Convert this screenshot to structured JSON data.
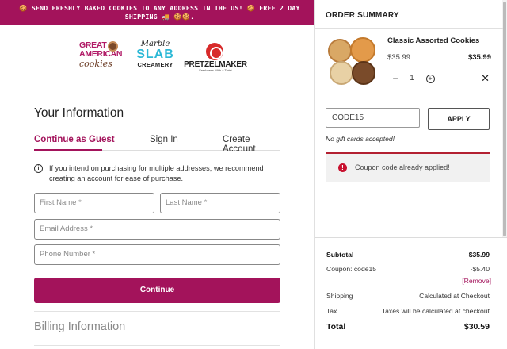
{
  "promo": {
    "text": "🍪 SEND FRESHLY BAKED COOKIES TO ANY ADDRESS IN THE US! 🍪 FREE 2 DAY SHIPPING 🚚 🍪🍪."
  },
  "brands": {
    "great_american": {
      "line1": "GREAT",
      "line2": "AMERICAN",
      "line3": "cookies"
    },
    "marble_slab": {
      "line1": "Marble",
      "line2": "SLAB",
      "line3": "CREAMERY"
    },
    "pretzelmaker": {
      "name": "PRETZELMAKER",
      "tagline": "Freshness With a Twist"
    }
  },
  "checkout": {
    "title": "Your Information",
    "tabs": [
      {
        "label": "Continue as Guest",
        "active": true
      },
      {
        "label": "Sign In",
        "active": false
      },
      {
        "label": "Create Account",
        "active": false
      }
    ],
    "info": {
      "text_before": "If you intend on purchasing for multiple addresses, we recommend ",
      "link": "creating an account",
      "text_after": " for ease of purchase."
    },
    "fields": {
      "first_name": "First Name *",
      "last_name": "Last Name *",
      "email": "Email Address *",
      "phone": "Phone Number *"
    },
    "continue_label": "Continue",
    "billing_title": "Billing Information"
  },
  "order_summary": {
    "title": "ORDER SUMMARY",
    "item": {
      "name": "Classic Assorted Cookies",
      "unit_price": "$35.99",
      "line_total": "$35.99",
      "quantity": "1",
      "minus": "−",
      "plus": "+",
      "remove": "✕"
    },
    "promo_code": {
      "value": "CODE15",
      "apply_label": "APPLY",
      "note": "No gift cards accepted!",
      "alert_icon": "!",
      "alert": "Coupon code already applied!"
    },
    "totals": {
      "subtotal_label": "Subtotal",
      "subtotal": "$35.99",
      "coupon_label": "Coupon: code15",
      "coupon": "-$5.40",
      "remove_label": "[Remove]",
      "shipping_label": "Shipping",
      "shipping": "Calculated at Checkout",
      "tax_label": "Tax",
      "tax": "Taxes will be calculated at checkout",
      "total_label": "Total",
      "total": "$30.59"
    }
  },
  "colors": {
    "brand": "#a3135b",
    "alert_red": "#c8102e"
  },
  "icons": {
    "info": "info-icon",
    "alert": "error-icon",
    "remove": "close-icon"
  }
}
